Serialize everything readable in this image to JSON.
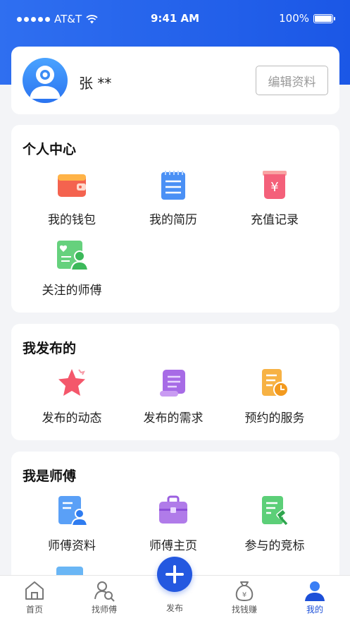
{
  "status_bar": {
    "carrier": "AT&T",
    "time": "9:41 AM",
    "battery": "100%"
  },
  "profile": {
    "name": "张 **",
    "edit_label": "编辑资料"
  },
  "personal_center": {
    "title": "个人中心",
    "items": [
      {
        "label": "我的钱包",
        "icon": "wallet-icon"
      },
      {
        "label": "我的简历",
        "icon": "resume-icon"
      },
      {
        "label": "充值记录",
        "icon": "recharge-record-icon"
      },
      {
        "label": "关注的师傅",
        "icon": "followed-masters-icon"
      }
    ]
  },
  "my_posts": {
    "title": "我发布的",
    "items": [
      {
        "label": "发布的动态",
        "icon": "star-icon"
      },
      {
        "label": "发布的需求",
        "icon": "scroll-icon"
      },
      {
        "label": "预约的服务",
        "icon": "appointment-icon"
      }
    ]
  },
  "i_am_master": {
    "title": "我是师傅",
    "items": [
      {
        "label": "师傅资料",
        "icon": "profile-doc-icon"
      },
      {
        "label": "师傅主页",
        "icon": "toolbox-icon"
      },
      {
        "label": "参与的竞标",
        "icon": "bid-icon"
      }
    ]
  },
  "tabbar": {
    "home": "首页",
    "find_master": "找师傅",
    "publish": "发布",
    "earn": "找钱赚",
    "mine": "我的"
  },
  "colors": {
    "primary": "#1c4fd8",
    "header": "#2563eb"
  }
}
